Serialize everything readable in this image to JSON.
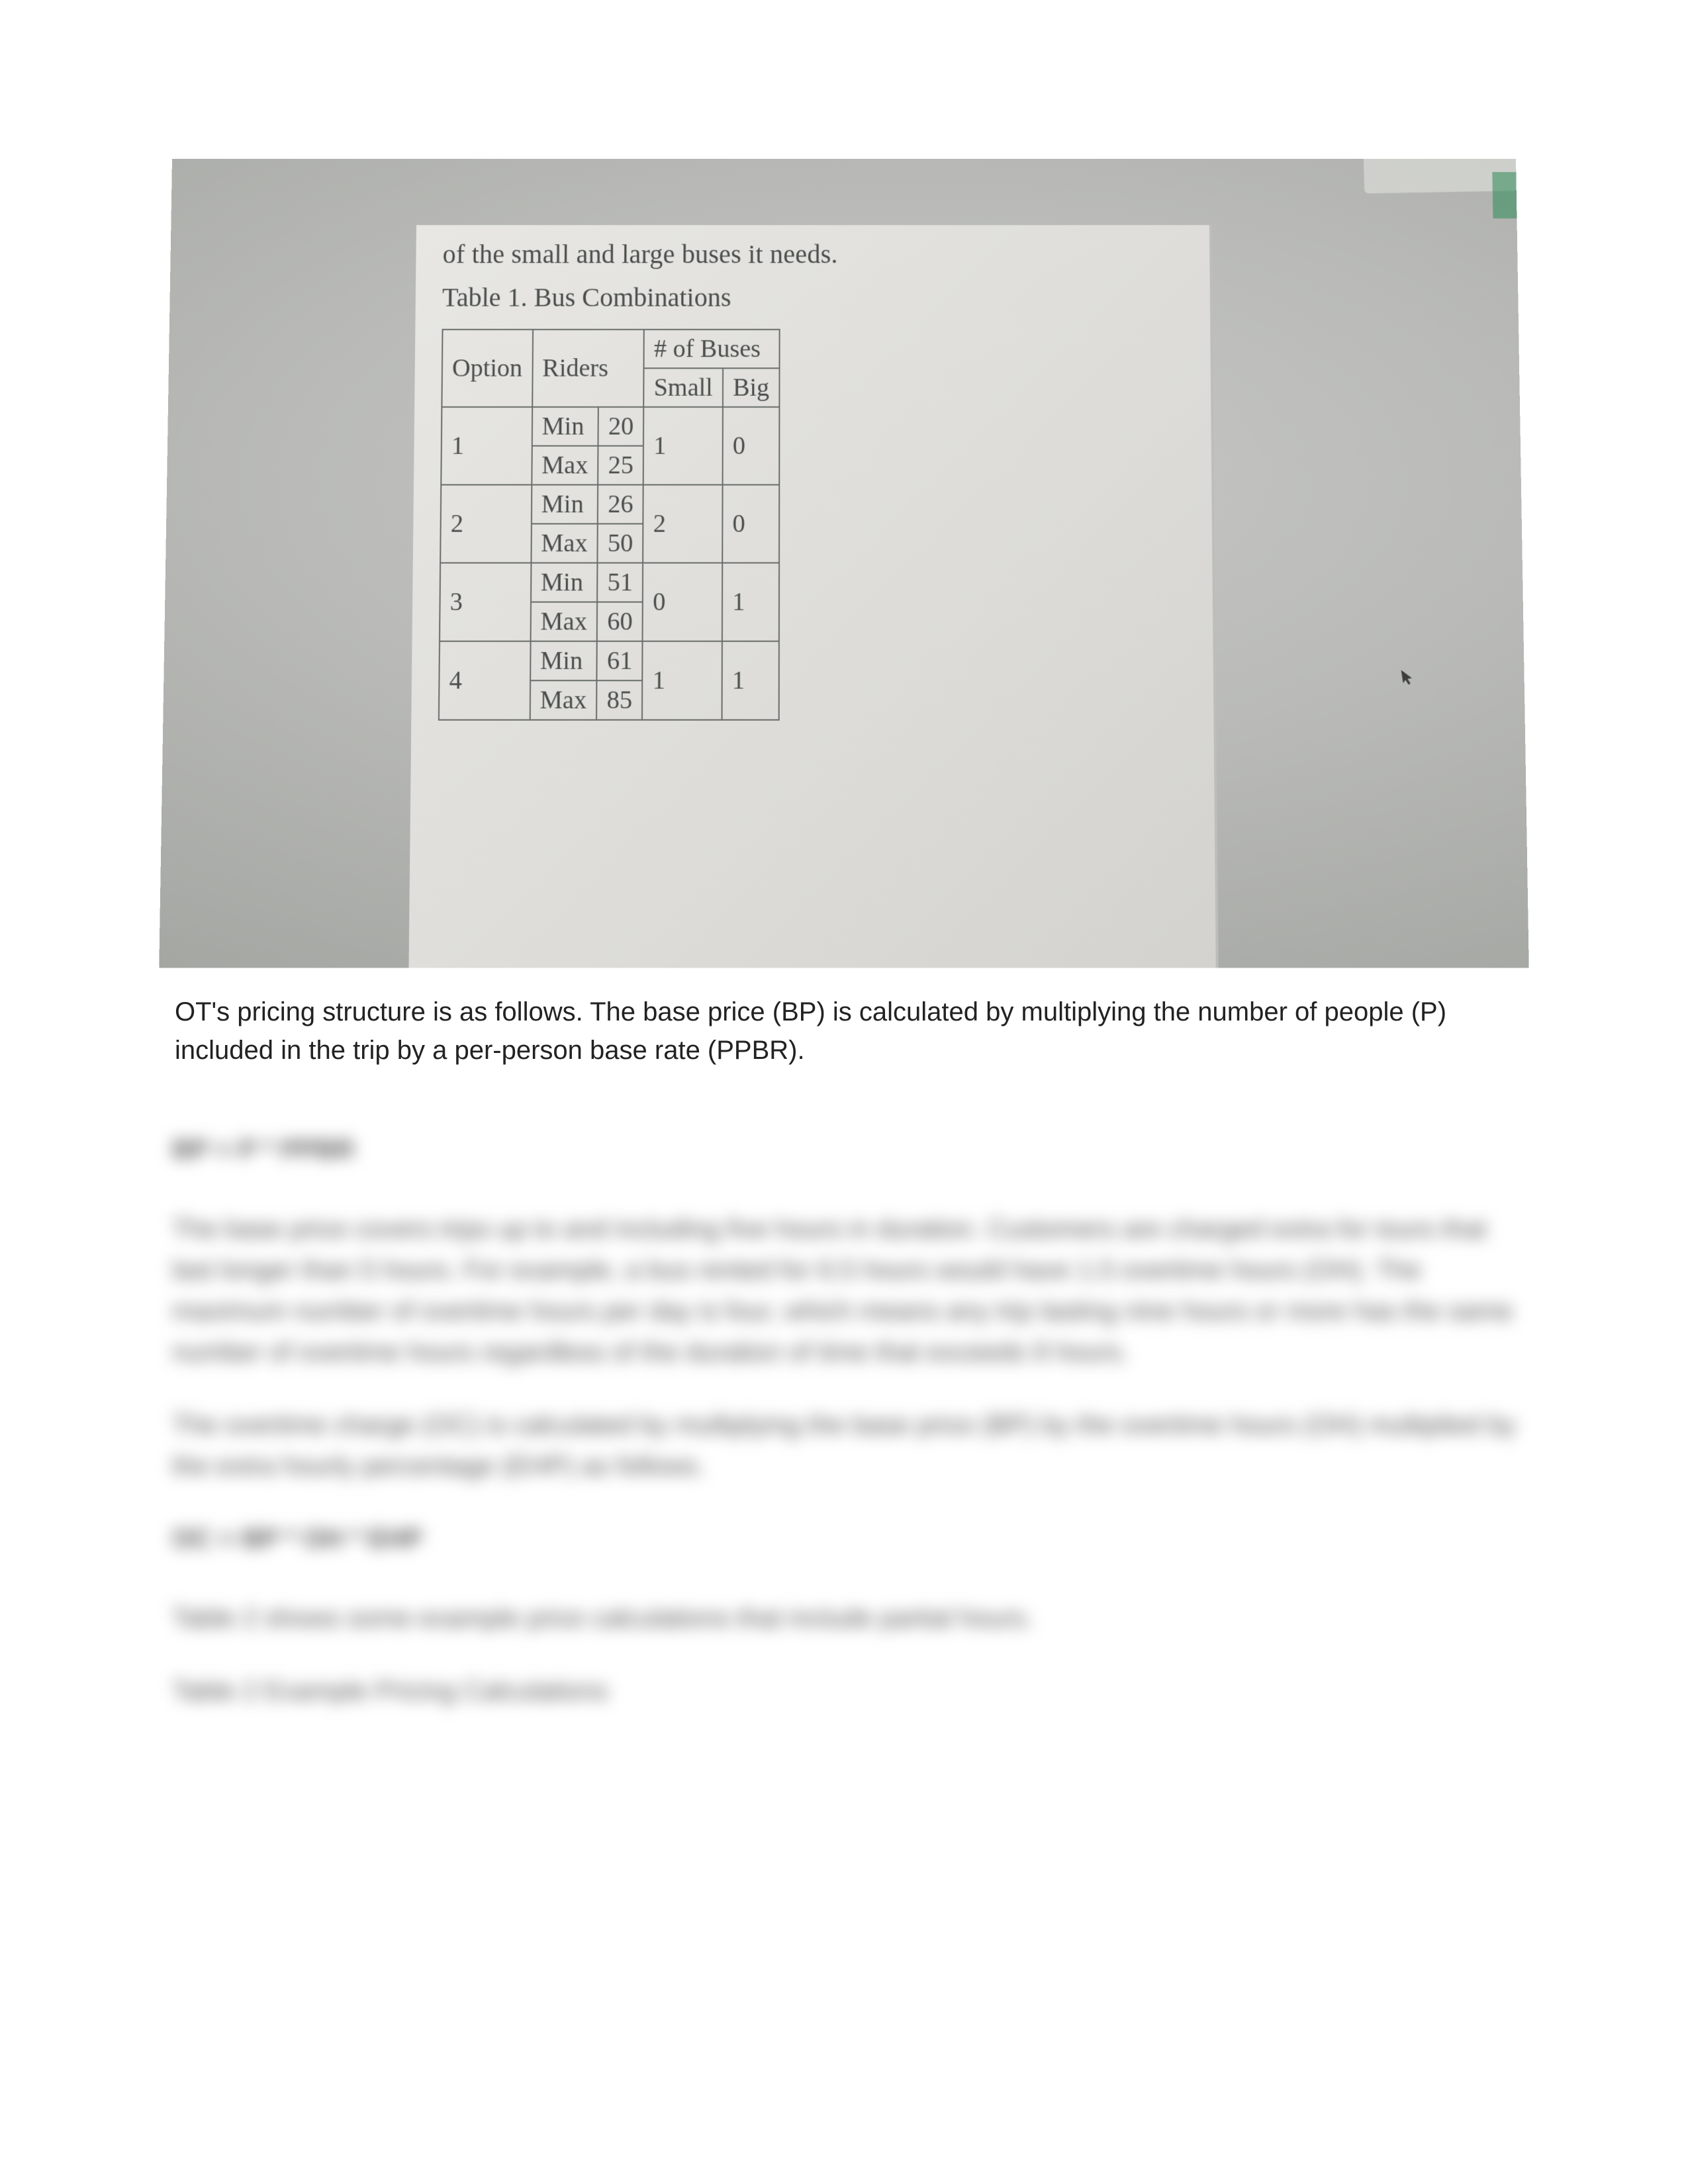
{
  "photo": {
    "lead_in": "of the small and large buses it needs.",
    "table_caption": "Table 1. Bus Combinations",
    "headers": {
      "option": "Option",
      "riders": "Riders",
      "buses_group": "# of Buses",
      "small": "Small",
      "big": "Big",
      "min": "Min",
      "max": "Max"
    },
    "rows": [
      {
        "option": "1",
        "min": "20",
        "max": "25",
        "small": "1",
        "big": "0"
      },
      {
        "option": "2",
        "min": "26",
        "max": "50",
        "small": "2",
        "big": "0"
      },
      {
        "option": "3",
        "min": "51",
        "max": "60",
        "small": "0",
        "big": "1"
      },
      {
        "option": "4",
        "min": "61",
        "max": "85",
        "small": "1",
        "big": "1"
      }
    ]
  },
  "clear_paragraph": "OT's pricing structure is as follows. The base price (BP) is calculated by multiplying the number of people (P) included in the trip by a per-person base rate (PPBR).",
  "locked": {
    "formula1": "BP = P * PPBR",
    "para1": "The base price covers trips up to and including five hours in duration. Customers are charged extra for tours that last longer than 5 hours. For example, a bus rented for 6.5 hours would have 1.5 overtime hours (OH). The maximum number of overtime hours per day is four, which means any trip lasting nine hours or more has the same number of overtime hours regardless of the duration of time that exceeds 9 hours.",
    "para2": "The overtime charge (OC) is calculated by multiplying the base price (BP) by the overtime hours (OH) multiplied by the extra hourly percentage (EHP) as follows.",
    "formula2": "OC = BP * OH * EHP",
    "line3": "Table 2 shows some example price calculations that include partial hours.",
    "line4": "Table 2 Example Pricing Calculations"
  }
}
